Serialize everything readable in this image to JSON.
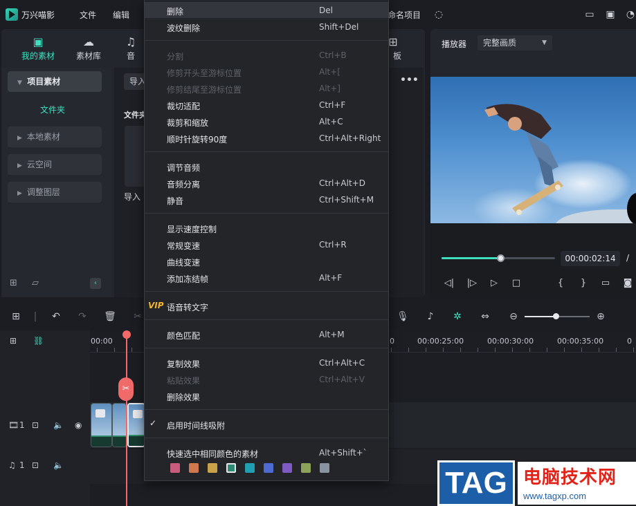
{
  "app": {
    "title": "万兴喵影",
    "menus": [
      "文件",
      "编辑"
    ],
    "project_name": "命名项目"
  },
  "media_panel": {
    "tabs": [
      {
        "label": "我的素材",
        "icon": "media-icon",
        "active": true
      },
      {
        "label": "素材库",
        "icon": "library-icon",
        "active": false
      },
      {
        "label": "音",
        "icon": "music-icon",
        "active": false
      },
      {
        "label": "板",
        "icon": "template-icon",
        "active": false
      }
    ],
    "sidebar": {
      "project_media": "项目素材",
      "folder": "文件夹",
      "local_media": "本地素材",
      "cloud": "云空间",
      "adjust_layer": "调整图层"
    },
    "import_button": "导入",
    "folder_header": "文件夹",
    "import_tile_label": "导入"
  },
  "player": {
    "label": "播放器",
    "quality": "完整画质",
    "timecode": "00:00:02:14",
    "slash": "/",
    "progress": 0.52
  },
  "timeline": {
    "ruler_labels": [
      "00:00",
      "00:00:25:00",
      "00:00:30:00",
      "00:00:35:00"
    ],
    "video_track_label": "1",
    "audio_track_label": "1",
    "zoom": 0.48
  },
  "context_menu": {
    "groups": [
      [
        {
          "label": "删除",
          "shortcut": "Del",
          "enabled": true,
          "hover": true
        },
        {
          "label": "波纹删除",
          "shortcut": "Shift+Del",
          "enabled": true
        }
      ],
      [
        {
          "label": "分割",
          "shortcut": "Ctrl+B",
          "enabled": false
        },
        {
          "label": "修剪开头至游标位置",
          "shortcut": "Alt+[",
          "enabled": false
        },
        {
          "label": "修剪结尾至游标位置",
          "shortcut": "Alt+]",
          "enabled": false
        },
        {
          "label": "裁切适配",
          "shortcut": "Ctrl+F",
          "enabled": true
        },
        {
          "label": "裁剪和缩放",
          "shortcut": "Alt+C",
          "enabled": true
        },
        {
          "label": "顺时针旋转90度",
          "shortcut": "Ctrl+Alt+Right",
          "enabled": true
        }
      ],
      [
        {
          "label": "调节音频",
          "shortcut": "",
          "enabled": true
        },
        {
          "label": "音频分离",
          "shortcut": "Ctrl+Alt+D",
          "enabled": true
        },
        {
          "label": "静音",
          "shortcut": "Ctrl+Shift+M",
          "enabled": true
        }
      ],
      [
        {
          "label": "显示速度控制",
          "shortcut": "",
          "enabled": true
        },
        {
          "label": "常规变速",
          "shortcut": "Ctrl+R",
          "enabled": true
        },
        {
          "label": "曲线变速",
          "shortcut": "",
          "enabled": true
        },
        {
          "label": "添加冻结帧",
          "shortcut": "Alt+F",
          "enabled": true
        }
      ],
      [
        {
          "label": "语音转文字",
          "shortcut": "",
          "enabled": true,
          "vip": "VIP"
        }
      ],
      [
        {
          "label": "颜色匹配",
          "shortcut": "Alt+M",
          "enabled": true
        }
      ],
      [
        {
          "label": "复制效果",
          "shortcut": "Ctrl+Alt+C",
          "enabled": true
        },
        {
          "label": "粘贴效果",
          "shortcut": "Ctrl+Alt+V",
          "enabled": false
        },
        {
          "label": "删除效果",
          "shortcut": "",
          "enabled": true
        }
      ],
      [
        {
          "label": "启用时间线吸附",
          "shortcut": "",
          "enabled": true,
          "checked": true
        }
      ],
      [
        {
          "label": "快速选中相同颜色的素材",
          "shortcut": "Alt+Shift+`",
          "enabled": true
        }
      ]
    ],
    "swatches": [
      "#c75c7e",
      "#d2784f",
      "#c9a24a",
      "#2f8a74",
      "#1f9fb1",
      "#4d6bd1",
      "#7e5bc2",
      "#8ea35a",
      "#8a94a0"
    ],
    "selected_swatch": 3
  },
  "watermark": {
    "tag": "TAG",
    "site_name": "电脑技术网",
    "url": "www.tagxp.com"
  }
}
